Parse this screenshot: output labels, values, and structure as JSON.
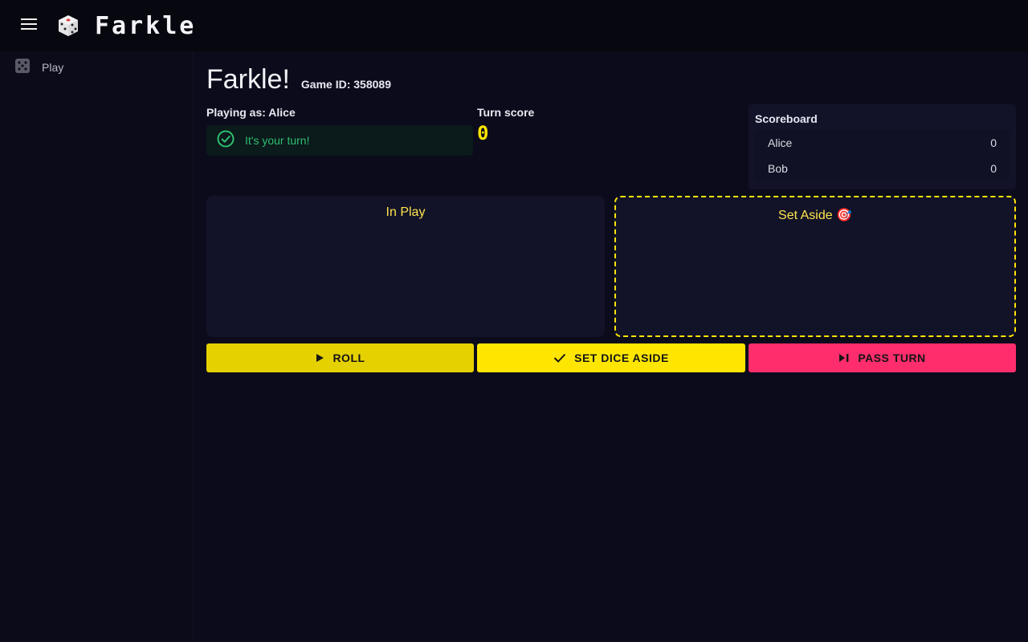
{
  "app": {
    "title": "Farkle"
  },
  "sidebar": {
    "items": [
      {
        "label": "Play"
      }
    ]
  },
  "main": {
    "page_title": "Farkle!",
    "game_id": "Game ID: 358089",
    "playing_as_prefix": "Playing as: ",
    "player_name": "Alice",
    "turn_message": "It's your turn!",
    "turn_score_label": "Turn score",
    "turn_score_value": "0"
  },
  "scoreboard": {
    "title": "Scoreboard",
    "rows": [
      {
        "name": "Alice",
        "score": "0"
      },
      {
        "name": "Bob",
        "score": "0"
      }
    ]
  },
  "panels": {
    "in_play": "In Play",
    "set_aside": "Set Aside 🎯"
  },
  "actions": {
    "roll": "ROLL",
    "set_aside": "SET DICE ASIDE",
    "pass": "PASS TURN"
  },
  "colors": {
    "accent_yellow": "#ffe600",
    "accent_pink": "#ff2d6c",
    "success_green": "#2fbf71",
    "background": "#0b0b19"
  },
  "icons": {
    "menu": "menu-icon",
    "logo": "die-icon",
    "sidebar_play": "dice-icon",
    "turn_alert": "check-circle-icon",
    "roll": "play-icon",
    "set_aside": "check-icon",
    "pass": "skip-next-icon"
  }
}
